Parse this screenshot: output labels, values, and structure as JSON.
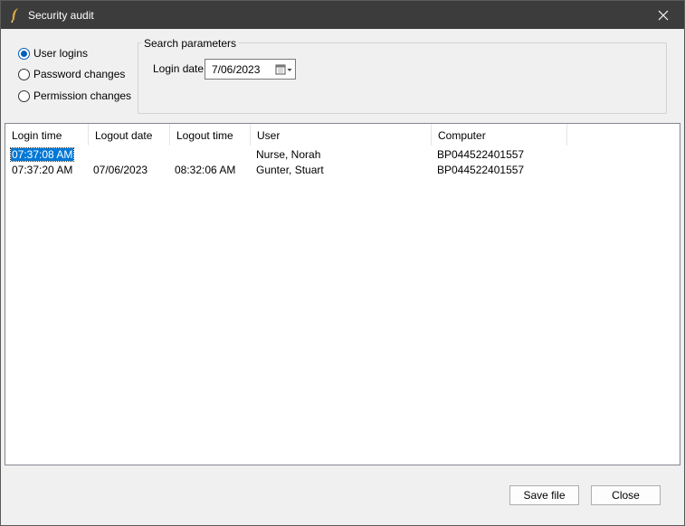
{
  "window": {
    "title": "Security audit"
  },
  "audit_type": {
    "options": [
      {
        "label": "User logins",
        "checked": true
      },
      {
        "label": "Password changes",
        "checked": false
      },
      {
        "label": "Permission changes",
        "checked": false
      }
    ]
  },
  "search": {
    "group_title": "Search parameters",
    "login_date_label": "Login date:",
    "login_date_value": "7/06/2023"
  },
  "table": {
    "columns": [
      "Login time",
      "Logout date",
      "Logout time",
      "User",
      "Computer"
    ],
    "rows": [
      {
        "login_time": "07:37:08 AM",
        "logout_date": "",
        "logout_time": "",
        "user": "Nurse, Norah",
        "computer": "BP044522401557"
      },
      {
        "login_time": "07:37:20 AM",
        "logout_date": "07/06/2023",
        "logout_time": "08:32:06 AM",
        "user": "Gunter, Stuart",
        "computer": "BP044522401557"
      }
    ]
  },
  "buttons": {
    "save_file": "Save file",
    "close": "Close"
  },
  "colors": {
    "titlebar": "#3c3c3c",
    "selection": "#0078d7",
    "radio_accent": "#005fb8"
  }
}
